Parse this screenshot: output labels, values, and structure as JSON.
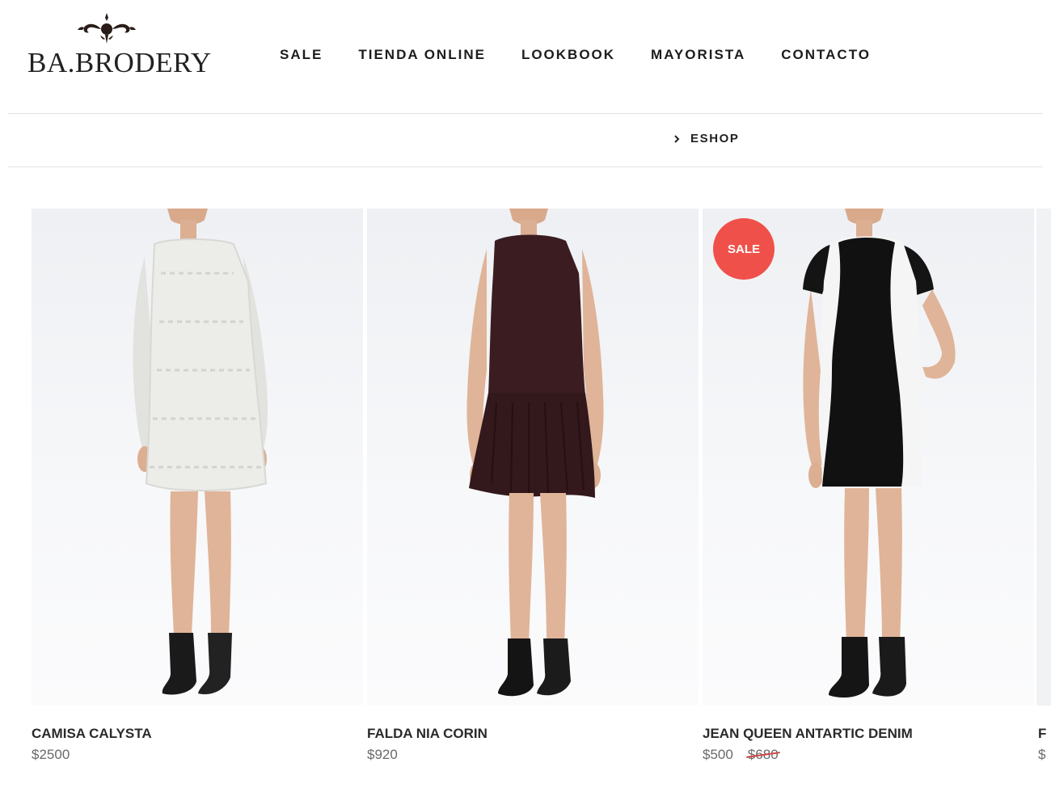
{
  "brand": {
    "name": "BA.BRODERY"
  },
  "nav": {
    "items": [
      "SALE",
      "TIENDA ONLINE",
      "LOOKBOOK",
      "MAYORISTA",
      "CONTACTO"
    ]
  },
  "breadcrumb": {
    "label": "ESHOP"
  },
  "products": [
    {
      "name": "CAMISA CALYSTA",
      "price": "$2500",
      "old_price": "",
      "badge": ""
    },
    {
      "name": "FALDA NIA CORIN",
      "price": "$920",
      "old_price": "",
      "badge": ""
    },
    {
      "name": "JEAN QUEEN ANTARTIC DENIM",
      "price": "$500",
      "old_price": "$680",
      "badge": "SALE"
    }
  ],
  "partial_product": {
    "name_fragment": "F",
    "price_fragment": "$"
  },
  "colors": {
    "sale_badge": "#f0504a",
    "strike": "#d04646",
    "text": "#222222",
    "price": "#6a6a6a"
  }
}
